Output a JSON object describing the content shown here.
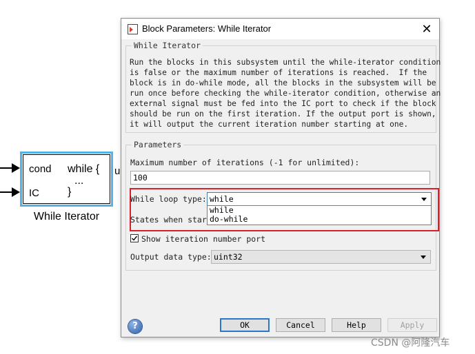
{
  "canvas": {
    "block": {
      "port_cond": "cond",
      "port_ic": "IC",
      "code_line1": "while {",
      "code_line2": "...",
      "code_line3": "}",
      "caption": "While Iterator",
      "output_stub": "u"
    }
  },
  "dialog": {
    "title": "Block Parameters: While Iterator",
    "description_group": {
      "legend": "While Iterator",
      "text": "Run the blocks in this subsystem until the while-iterator condition\nis false or the maximum number of iterations is reached.  If the\nblock is in do-while mode, all the blocks in the subsystem will be\nrun once before checking the while-iterator condition, otherwise an\nexternal signal must be fed into the IC port to check if the block\nshould be run on the first iteration. If the output port is shown,\nit will output the current iteration number starting at one."
    },
    "parameters_group": {
      "legend": "Parameters",
      "max_iterations_label": "Maximum number of iterations (-1 for unlimited):",
      "max_iterations_value": "100",
      "loop_type_label": "While loop type:",
      "loop_type_selected": "while",
      "loop_type_options": [
        "while",
        "do-while"
      ],
      "states_label": "States when start",
      "show_port_label": "Show iteration number port",
      "show_port_checked": true,
      "output_type_label": "Output data type:",
      "output_type_value": "uint32"
    },
    "buttons": {
      "ok": "OK",
      "cancel": "Cancel",
      "help": "Help",
      "apply": "Apply"
    }
  },
  "watermark": "CSDN @阿隆汽车",
  "colors": {
    "block_border": "#54b1e6",
    "highlight": "#d9202a",
    "ok_focus": "#2a78c5"
  }
}
